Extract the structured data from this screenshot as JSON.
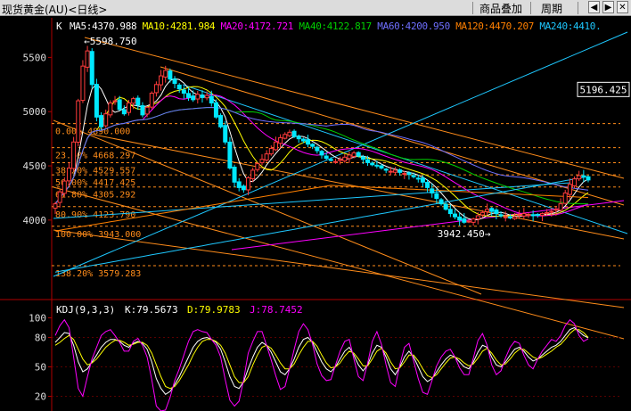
{
  "window": {
    "title": "现货黄金(AU)<日线>",
    "buttons": {
      "overlay": "商品叠加",
      "period": "周期"
    }
  },
  "colors": {
    "background": "#000000",
    "up": "#ff3b3b",
    "down": "#00e8ff",
    "ma5": "#ffffff",
    "ma10": "#ffff00",
    "ma20": "#ff00ff",
    "ma40": "#00d000",
    "ma60": "#6f6fff",
    "ma120": "#ff8000",
    "ma240": "#1ec8ff",
    "fib": "#ff8c1a",
    "k_line": "#ffffff",
    "d_line": "#ffff00",
    "j_line": "#ff00ff"
  },
  "chart_data": [
    {
      "type": "candlestick",
      "symbol": "现货黄金(AU)",
      "period": "日线",
      "header_prefix": "K",
      "ylim": [
        3300,
        5750
      ],
      "yticks": [
        4000,
        4500,
        5000,
        5500
      ],
      "ma_legend": [
        {
          "label": "MA5:4370.988",
          "color": "#ffffff"
        },
        {
          "label": "MA10:4281.984",
          "color": "#ffff00"
        },
        {
          "label": "MA20:4172.721",
          "color": "#ff00ff"
        },
        {
          "label": "MA40:4122.817",
          "color": "#00d000"
        },
        {
          "label": "MA60:4200.950",
          "color": "#6f6fff"
        },
        {
          "label": "MA120:4470.207",
          "color": "#ff8000"
        },
        {
          "label": "MA240:4410.",
          "color": "#1ec8ff"
        }
      ],
      "current_price": "5196.425",
      "high_marker": "5598.750",
      "low_marker": "3942.450",
      "fibonacci": [
        {
          "label": "0.00% 4890.000",
          "value": 4890.0
        },
        {
          "label": "23.60% 4668.297",
          "value": 4668.297
        },
        {
          "label": "38.20% 4529.557",
          "value": 4529.557
        },
        {
          "label": "50.00% 4417.425",
          "value": 4417.425
        },
        {
          "label": "61.80% 4305.292",
          "value": 4305.292
        },
        {
          "label": "80.90% 4123.790",
          "value": 4123.79
        },
        {
          "label": "100.00% 3943.000",
          "value": 3943.0
        },
        {
          "label": "138.20% 3579.283",
          "value": 3579.283
        }
      ],
      "closes": [
        4150,
        4260,
        4360,
        4480,
        4720,
        5100,
        5420,
        5560,
        5250,
        4950,
        4860,
        4980,
        5080,
        5100,
        5020,
        4980,
        5080,
        5120,
        5060,
        4970,
        5040,
        5170,
        5250,
        5330,
        5380,
        5300,
        5260,
        5210,
        5170,
        5130,
        5110,
        5160,
        5130,
        5150,
        5080,
        4950,
        4860,
        4720,
        4480,
        4350,
        4300,
        4280,
        4390,
        4460,
        4520,
        4560,
        4610,
        4660,
        4720,
        4760,
        4790,
        4810,
        4770,
        4750,
        4730,
        4700,
        4680,
        4640,
        4600,
        4570,
        4550,
        4540,
        4560,
        4580,
        4600,
        4620,
        4590,
        4560,
        4530,
        4510,
        4500,
        4480,
        4460,
        4450,
        4460,
        4440,
        4430,
        4420,
        4400,
        4380,
        4350,
        4300,
        4250,
        4200,
        4150,
        4100,
        4060,
        4030,
        4000,
        3980,
        3990,
        4010,
        4040,
        4070,
        4100,
        4080,
        4060,
        4040,
        4030,
        4020,
        4030,
        4050,
        4060,
        4050,
        4040,
        4050,
        4060,
        4070,
        4080,
        4100,
        4150,
        4250,
        4330,
        4380,
        4410,
        4400,
        4370
      ],
      "k_label": "K:79.5673",
      "d_label": "D:79.9783",
      "j_label": "J:78.7452"
    },
    {
      "type": "line",
      "indicator": "KDJ(9,3,3)",
      "ylim": [
        5,
        115
      ],
      "yticks": [
        20,
        50,
        80,
        100
      ],
      "series": [
        {
          "name": "K",
          "values": [
            75,
            80,
            85,
            84,
            72,
            55,
            45,
            48,
            55,
            62,
            70,
            75,
            78,
            78,
            76,
            72,
            70,
            74,
            76,
            74,
            68,
            55,
            38,
            28,
            22,
            25,
            32,
            40,
            50,
            60,
            70,
            76,
            79,
            80,
            78,
            75,
            68,
            55,
            40,
            30,
            28,
            35,
            48,
            60,
            70,
            75,
            72,
            65,
            55,
            45,
            42,
            48,
            58,
            70,
            78,
            80,
            75,
            65,
            55,
            48,
            45,
            50,
            58,
            66,
            70,
            62,
            52,
            46,
            52,
            64,
            72,
            70,
            60,
            48,
            42,
            50,
            60,
            66,
            60,
            50,
            40,
            35,
            38,
            45,
            52,
            58,
            62,
            60,
            55,
            50,
            48,
            55,
            65,
            72,
            70,
            60,
            52,
            50,
            55,
            62,
            68,
            70,
            66,
            60,
            56,
            58,
            62,
            66,
            70,
            72,
            76,
            82,
            88,
            90,
            86,
            82,
            79.6
          ]
        },
        {
          "name": "D",
          "values": [
            72,
            75,
            79,
            82,
            78,
            68,
            58,
            52,
            54,
            58,
            64,
            70,
            74,
            77,
            77,
            75,
            72,
            73,
            75,
            75,
            72,
            64,
            52,
            40,
            30,
            28,
            30,
            36,
            44,
            52,
            62,
            70,
            76,
            78,
            78,
            76,
            72,
            64,
            52,
            40,
            34,
            34,
            40,
            52,
            62,
            70,
            72,
            69,
            62,
            54,
            48,
            48,
            53,
            62,
            70,
            76,
            76,
            71,
            62,
            54,
            49,
            50,
            54,
            61,
            66,
            64,
            58,
            51,
            51,
            58,
            66,
            69,
            64,
            55,
            48,
            49,
            55,
            62,
            62,
            56,
            48,
            41,
            39,
            42,
            48,
            54,
            59,
            60,
            58,
            54,
            51,
            53,
            59,
            66,
            69,
            64,
            57,
            52,
            53,
            58,
            64,
            68,
            68,
            64,
            60,
            58,
            60,
            63,
            66,
            70,
            73,
            78,
            84,
            88,
            88,
            85,
            80.0
          ]
        },
        {
          "name": "J",
          "values": [
            82,
            92,
            98,
            90,
            60,
            28,
            20,
            40,
            58,
            70,
            82,
            86,
            88,
            82,
            75,
            66,
            66,
            76,
            79,
            72,
            60,
            37,
            10,
            5,
            6,
            19,
            36,
            48,
            62,
            76,
            86,
            88,
            86,
            85,
            78,
            72,
            60,
            37,
            16,
            10,
            15,
            37,
            64,
            76,
            86,
            86,
            72,
            57,
            41,
            27,
            30,
            48,
            68,
            86,
            94,
            88,
            73,
            53,
            41,
            36,
            37,
            52,
            66,
            76,
            78,
            58,
            40,
            36,
            54,
            76,
            86,
            73,
            52,
            34,
            30,
            52,
            70,
            74,
            56,
            38,
            24,
            22,
            36,
            51,
            60,
            66,
            68,
            60,
            49,
            42,
            42,
            59,
            77,
            84,
            72,
            52,
            42,
            46,
            59,
            70,
            76,
            74,
            62,
            52,
            48,
            58,
            66,
            72,
            78,
            76,
            82,
            92,
            98,
            94,
            82,
            76,
            78.7
          ]
        }
      ]
    }
  ]
}
